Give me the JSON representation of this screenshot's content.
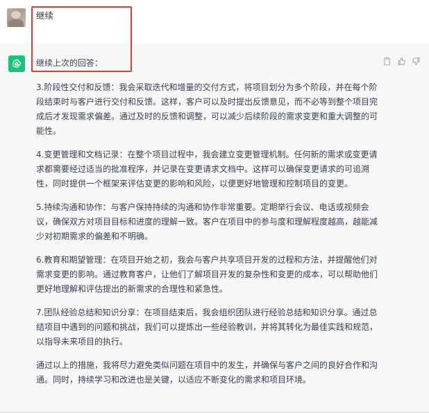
{
  "user_message": {
    "text": "继续"
  },
  "assistant_message": {
    "intro": "继续上次的回答：",
    "paragraphs": [
      "3.阶段性交付和反馈：我会采取迭代和增量的交付方式，将项目划分为多个阶段，并在每个阶段结束时与客户进行交付和反馈。这样，客户可以及时提出反馈意见，而不必等到整个项目完成后才发现需求偏差。通过及时的反馈和调整，可以减少后续阶段的需求变更和重大调整的可能性。",
      "4.变更管理和文档记录：在整个项目过程中，我会建立变更管理机制。任何新的需求或变更请求都需要经过适当的批准程序，并记录在变更请求文档中。这样可以确保变更请求的可追溯性，同时提供一个框架来评估变更的影响和风险，以便更好地管理和控制项目的变更。",
      "5.持续沟通和协作：与客户保持持续的沟通和协作非常重要。定期举行会议、电话或视频会议，确保双方对项目目标和进度的理解一致。客户在项目中的参与度和理解程度越高，越能减少对初期需求的偏差和不明确。",
      "6.教育和期望管理：在项目开始之初，我会与客户共享项目开发的过程和方法，并提醒他们对需求变更的影响。通过教育客户，让他们了解项目开发的复杂性和变更的成本，可以帮助他们更好地理解和评估提出的新需求的合理性和紧急性。",
      "7.团队经验总结和知识分享：在项目结束后，我会组织团队进行经验总结和知识分享。通过总结项目中遇到的问题和挑战，我们可以提炼出一些经验教训，并将其转化为最佳实践和规范，以指导未来项目的执行。",
      "通过以上的措施，我将尽力避免类似问题在项目中的发生，并确保与客户之间的良好合作和沟通。同时，持续学习和改进也是关键，以适应不断变化的需求和项目环境。"
    ]
  },
  "icons": {
    "user_avatar": "user-avatar-photo",
    "bot_avatar": "openai-logo-icon",
    "copy": "clipboard-icon",
    "like": "thumbs-up-icon",
    "dislike": "thumbs-down-icon"
  },
  "colors": {
    "bot_avatar_bg": "#19c37d",
    "highlight_border": "#e53935",
    "assistant_bg": "#f7f7f8"
  }
}
